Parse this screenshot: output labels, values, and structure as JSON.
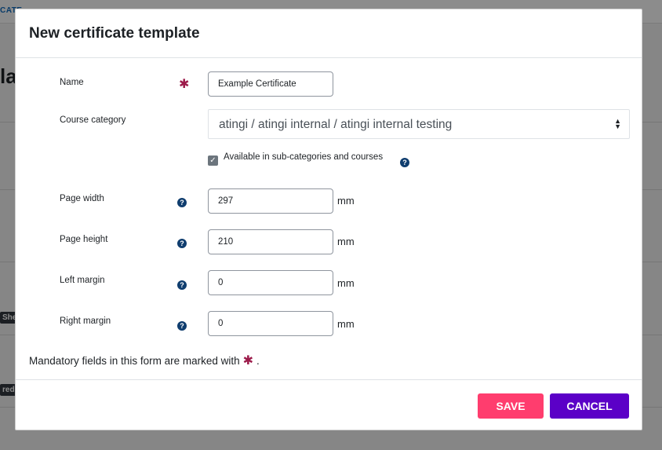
{
  "background": {
    "top_link": "CATE...",
    "heading": "la",
    "badges": [
      "She",
      "red"
    ]
  },
  "modal": {
    "title": "New certificate template",
    "fields": {
      "name": {
        "label": "Name",
        "value": "Example Certificate"
      },
      "course_category": {
        "label": "Course category",
        "selected": "atingi / atingi internal / atingi internal testing",
        "checkbox_label": "Available in sub-categories and courses",
        "checkbox_checked": true
      },
      "page_width": {
        "label": "Page width",
        "value": "297",
        "unit": "mm"
      },
      "page_height": {
        "label": "Page height",
        "value": "210",
        "unit": "mm"
      },
      "left_margin": {
        "label": "Left margin",
        "value": "0",
        "unit": "mm"
      },
      "right_margin": {
        "label": "Right margin",
        "value": "0",
        "unit": "mm"
      }
    },
    "mandatory_note": {
      "prefix": "Mandatory fields in this form are marked with",
      "suffix": "."
    },
    "buttons": {
      "save": "SAVE",
      "cancel": "CANCEL"
    }
  },
  "colors": {
    "required": "#9c1b4a",
    "help": "#0f3d6e",
    "save": "#ff3d6e",
    "cancel": "#5b00c7"
  },
  "icons": {
    "required": "asterisk-icon",
    "help": "question-circle-icon",
    "select": "sort-arrows-icon",
    "check": "checkmark-icon"
  }
}
